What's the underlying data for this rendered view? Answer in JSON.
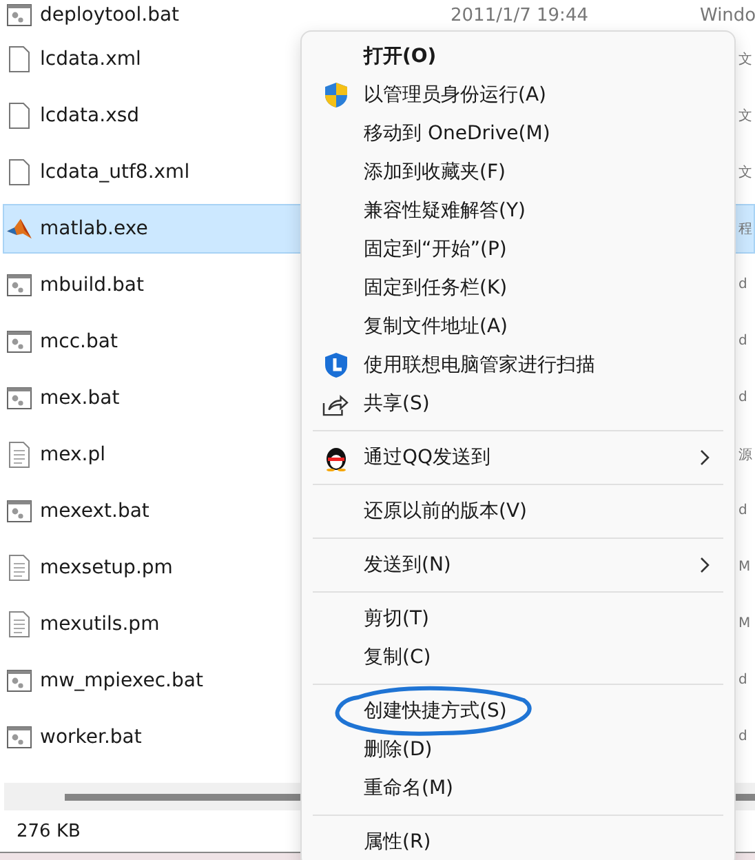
{
  "files": [
    {
      "name": "deploytool.bat",
      "kind": "batch",
      "selected": false,
      "date": "2011/1/7 19:44",
      "type": "Windo"
    },
    {
      "name": "lcdata.xml",
      "kind": "blank",
      "selected": false,
      "type": "文"
    },
    {
      "name": "lcdata.xsd",
      "kind": "blank",
      "selected": false,
      "type": "文"
    },
    {
      "name": "lcdata_utf8.xml",
      "kind": "blank",
      "selected": false,
      "type": "文"
    },
    {
      "name": "matlab.exe",
      "kind": "matlab",
      "selected": true,
      "type": "程"
    },
    {
      "name": "mbuild.bat",
      "kind": "batch",
      "selected": false,
      "type": "d"
    },
    {
      "name": "mcc.bat",
      "kind": "batch",
      "selected": false,
      "type": "d"
    },
    {
      "name": "mex.bat",
      "kind": "batch",
      "selected": false,
      "type": "d"
    },
    {
      "name": "mex.pl",
      "kind": "text",
      "selected": false,
      "type": "源"
    },
    {
      "name": "mexext.bat",
      "kind": "batch",
      "selected": false,
      "type": "d"
    },
    {
      "name": "mexsetup.pm",
      "kind": "text",
      "selected": false,
      "type": "M"
    },
    {
      "name": "mexutils.pm",
      "kind": "text",
      "selected": false,
      "type": "M"
    },
    {
      "name": "mw_mpiexec.bat",
      "kind": "batch",
      "selected": false,
      "type": "d"
    },
    {
      "name": "worker.bat",
      "kind": "batch",
      "selected": false,
      "type": "d"
    }
  ],
  "status_bar": {
    "size": "276 KB"
  },
  "context_menu": [
    {
      "kind": "item",
      "label": "打开(O)",
      "default": true,
      "submenu": false,
      "circled": false
    },
    {
      "kind": "shield",
      "label": "以管理员身份运行(A)",
      "default": false,
      "submenu": false,
      "circled": false
    },
    {
      "kind": "item",
      "label": "移动到 OneDrive(M)",
      "default": false,
      "submenu": false,
      "circled": false
    },
    {
      "kind": "item",
      "label": "添加到收藏夹(F)",
      "default": false,
      "submenu": false,
      "circled": false
    },
    {
      "kind": "item",
      "label": "兼容性疑难解答(Y)",
      "default": false,
      "submenu": false,
      "circled": false
    },
    {
      "kind": "item",
      "label": "固定到“开始”(P)",
      "default": false,
      "submenu": false,
      "circled": false
    },
    {
      "kind": "item",
      "label": "固定到任务栏(K)",
      "default": false,
      "submenu": false,
      "circled": false
    },
    {
      "kind": "item",
      "label": "复制文件地址(A)",
      "default": false,
      "submenu": false,
      "circled": false
    },
    {
      "kind": "lenovo",
      "label": "使用联想电脑管家进行扫描",
      "default": false,
      "submenu": false,
      "circled": false
    },
    {
      "kind": "share",
      "label": "共享(S)",
      "default": false,
      "submenu": false,
      "circled": false
    },
    {
      "kind": "separator"
    },
    {
      "kind": "penguin",
      "label": "通过QQ发送到",
      "default": false,
      "submenu": true,
      "circled": false
    },
    {
      "kind": "separator"
    },
    {
      "kind": "item",
      "label": "还原以前的版本(V)",
      "default": false,
      "submenu": false,
      "circled": false
    },
    {
      "kind": "separator"
    },
    {
      "kind": "item",
      "label": "发送到(N)",
      "default": false,
      "submenu": true,
      "circled": false
    },
    {
      "kind": "separator"
    },
    {
      "kind": "item",
      "label": "剪切(T)",
      "default": false,
      "submenu": false,
      "circled": false
    },
    {
      "kind": "item",
      "label": "复制(C)",
      "default": false,
      "submenu": false,
      "circled": false
    },
    {
      "kind": "separator"
    },
    {
      "kind": "item",
      "label": "创建快捷方式(S)",
      "default": false,
      "submenu": false,
      "circled": true
    },
    {
      "kind": "item",
      "label": "删除(D)",
      "default": false,
      "submenu": false,
      "circled": false
    },
    {
      "kind": "item",
      "label": "重命名(M)",
      "default": false,
      "submenu": false,
      "circled": false
    },
    {
      "kind": "separator"
    },
    {
      "kind": "item",
      "label": "属性(R)",
      "default": false,
      "submenu": false,
      "circled": false
    }
  ]
}
